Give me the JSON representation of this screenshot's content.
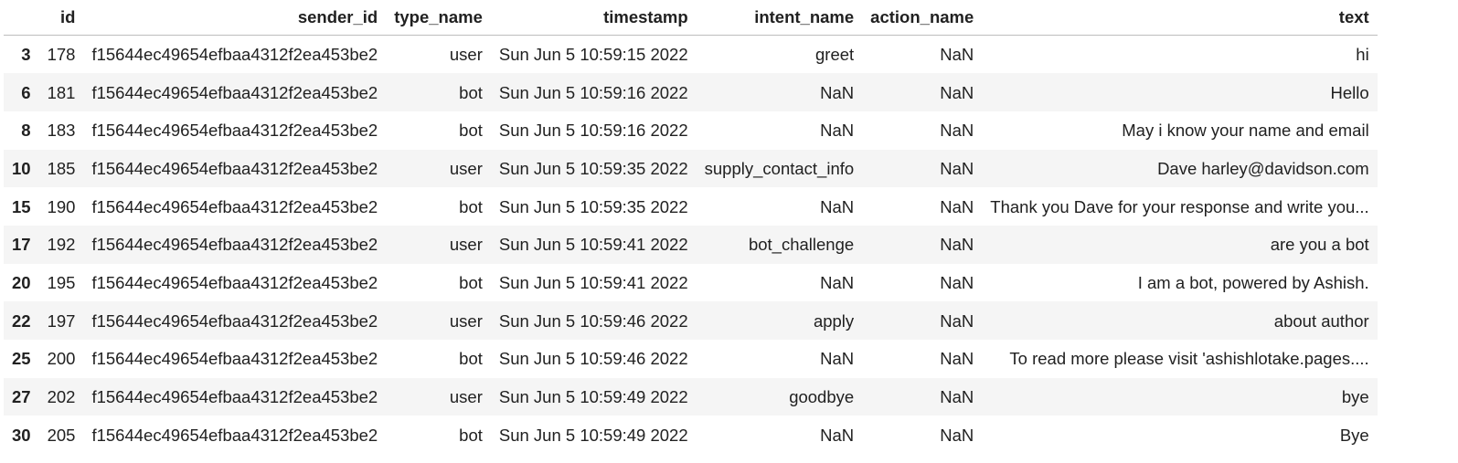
{
  "table": {
    "columns": [
      "",
      "id",
      "sender_id",
      "type_name",
      "timestamp",
      "intent_name",
      "action_name",
      "text"
    ],
    "rows": [
      {
        "index": "3",
        "id": "178",
        "sender_id": "f15644ec49654efbaa4312f2ea453be2",
        "type_name": "user",
        "timestamp": "Sun Jun 5 10:59:15 2022",
        "intent_name": "greet",
        "action_name": "NaN",
        "text": "hi"
      },
      {
        "index": "6",
        "id": "181",
        "sender_id": "f15644ec49654efbaa4312f2ea453be2",
        "type_name": "bot",
        "timestamp": "Sun Jun 5 10:59:16 2022",
        "intent_name": "NaN",
        "action_name": "NaN",
        "text": "Hello"
      },
      {
        "index": "8",
        "id": "183",
        "sender_id": "f15644ec49654efbaa4312f2ea453be2",
        "type_name": "bot",
        "timestamp": "Sun Jun 5 10:59:16 2022",
        "intent_name": "NaN",
        "action_name": "NaN",
        "text": "May i know your name and email"
      },
      {
        "index": "10",
        "id": "185",
        "sender_id": "f15644ec49654efbaa4312f2ea453be2",
        "type_name": "user",
        "timestamp": "Sun Jun 5 10:59:35 2022",
        "intent_name": "supply_contact_info",
        "action_name": "NaN",
        "text": "Dave harley@davidson.com"
      },
      {
        "index": "15",
        "id": "190",
        "sender_id": "f15644ec49654efbaa4312f2ea453be2",
        "type_name": "bot",
        "timestamp": "Sun Jun 5 10:59:35 2022",
        "intent_name": "NaN",
        "action_name": "NaN",
        "text": "Thank you Dave for your response and write you..."
      },
      {
        "index": "17",
        "id": "192",
        "sender_id": "f15644ec49654efbaa4312f2ea453be2",
        "type_name": "user",
        "timestamp": "Sun Jun 5 10:59:41 2022",
        "intent_name": "bot_challenge",
        "action_name": "NaN",
        "text": "are you a bot"
      },
      {
        "index": "20",
        "id": "195",
        "sender_id": "f15644ec49654efbaa4312f2ea453be2",
        "type_name": "bot",
        "timestamp": "Sun Jun 5 10:59:41 2022",
        "intent_name": "NaN",
        "action_name": "NaN",
        "text": "I am a bot, powered by Ashish."
      },
      {
        "index": "22",
        "id": "197",
        "sender_id": "f15644ec49654efbaa4312f2ea453be2",
        "type_name": "user",
        "timestamp": "Sun Jun 5 10:59:46 2022",
        "intent_name": "apply",
        "action_name": "NaN",
        "text": "about author"
      },
      {
        "index": "25",
        "id": "200",
        "sender_id": "f15644ec49654efbaa4312f2ea453be2",
        "type_name": "bot",
        "timestamp": "Sun Jun 5 10:59:46 2022",
        "intent_name": "NaN",
        "action_name": "NaN",
        "text": "To read more please visit 'ashishlotake.pages...."
      },
      {
        "index": "27",
        "id": "202",
        "sender_id": "f15644ec49654efbaa4312f2ea453be2",
        "type_name": "user",
        "timestamp": "Sun Jun 5 10:59:49 2022",
        "intent_name": "goodbye",
        "action_name": "NaN",
        "text": "bye"
      },
      {
        "index": "30",
        "id": "205",
        "sender_id": "f15644ec49654efbaa4312f2ea453be2",
        "type_name": "bot",
        "timestamp": "Sun Jun 5 10:59:49 2022",
        "intent_name": "NaN",
        "action_name": "NaN",
        "text": "Bye"
      }
    ]
  }
}
